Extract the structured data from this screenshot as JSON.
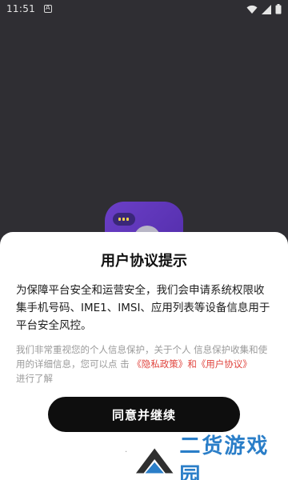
{
  "status_bar": {
    "time": "11:51"
  },
  "icons": {
    "status_a": "notification-a-icon",
    "wifi": "wifi-icon",
    "signal": "signal-icon",
    "battery": "battery-icon",
    "app": "app-logo-icon"
  },
  "dialog": {
    "title": "用户协议提示",
    "body": "为保障平台安全和运营安全，我们会申请系统权限收集手机号码、IME1、IMSI、应用列表等设备信息用于平台安全风控。",
    "sub_prefix": "我们非常重视您的个人信息保护，关于个人 信息保护收集和使用的详细信息，您可以点 击",
    "privacy_link": "《隐私政策》",
    "and": "和",
    "agreement_link": "《用户协议》",
    "sub_suffix": "进行了解",
    "agree_button": "同意并继续"
  },
  "watermark": {
    "text": "二货游戏园"
  },
  "colors": {
    "background": "#2f2e33",
    "sheet": "#ffffff",
    "button": "#0e0e0e",
    "link": "#e0443e",
    "watermark": "#2a7ec8"
  }
}
